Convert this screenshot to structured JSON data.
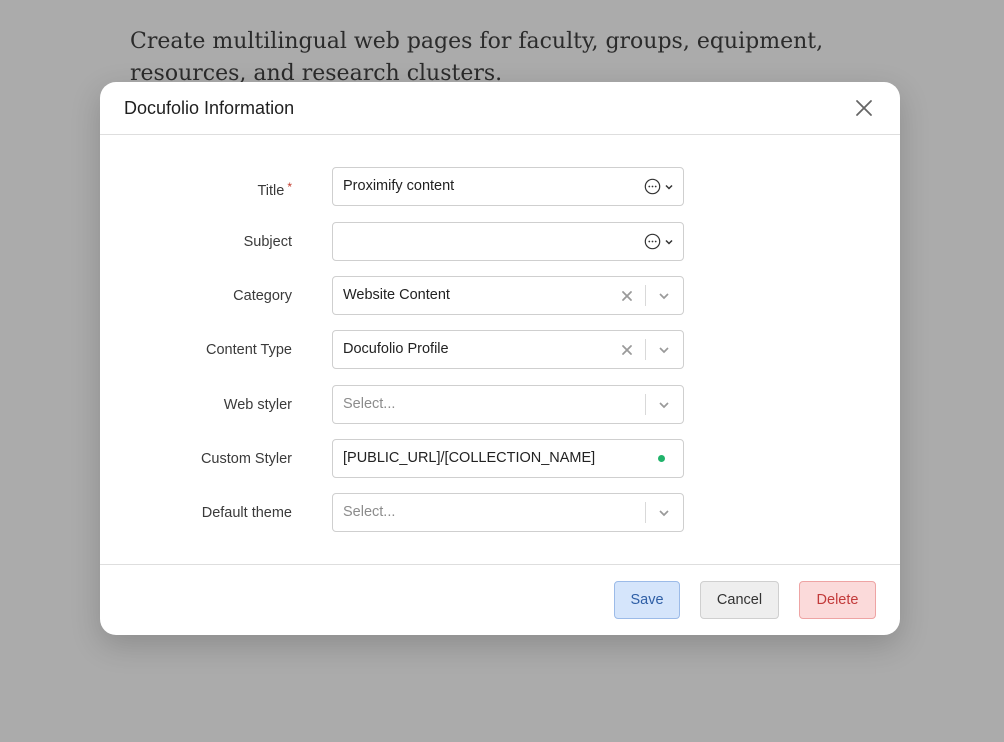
{
  "background": {
    "text": "Create multilingual web pages for faculty, groups, equipment, resources, and research clusters."
  },
  "modal": {
    "title": "Docufolio Information",
    "close_icon": "close-icon"
  },
  "fields": {
    "title": {
      "label": "Title",
      "required_mark": "*",
      "value": "Proximify content"
    },
    "subject": {
      "label": "Subject",
      "value": ""
    },
    "category": {
      "label": "Category",
      "value": "Website Content"
    },
    "content_type": {
      "label": "Content Type",
      "value": "Docufolio Profile"
    },
    "web_styler": {
      "label": "Web styler",
      "placeholder": "Select..."
    },
    "custom_styler": {
      "label": "Custom Styler",
      "value": "[PUBLIC_URL]/[COLLECTION_NAME]"
    },
    "default_theme": {
      "label": "Default theme",
      "placeholder": "Select..."
    }
  },
  "footer": {
    "save_label": "Save",
    "cancel_label": "Cancel",
    "delete_label": "Delete"
  },
  "colors": {
    "overlay": "#ababab",
    "save_bg": "#d5e5fb",
    "delete_bg": "#fbdada",
    "status_dot": "#21b36b",
    "required": "#c0392b"
  }
}
